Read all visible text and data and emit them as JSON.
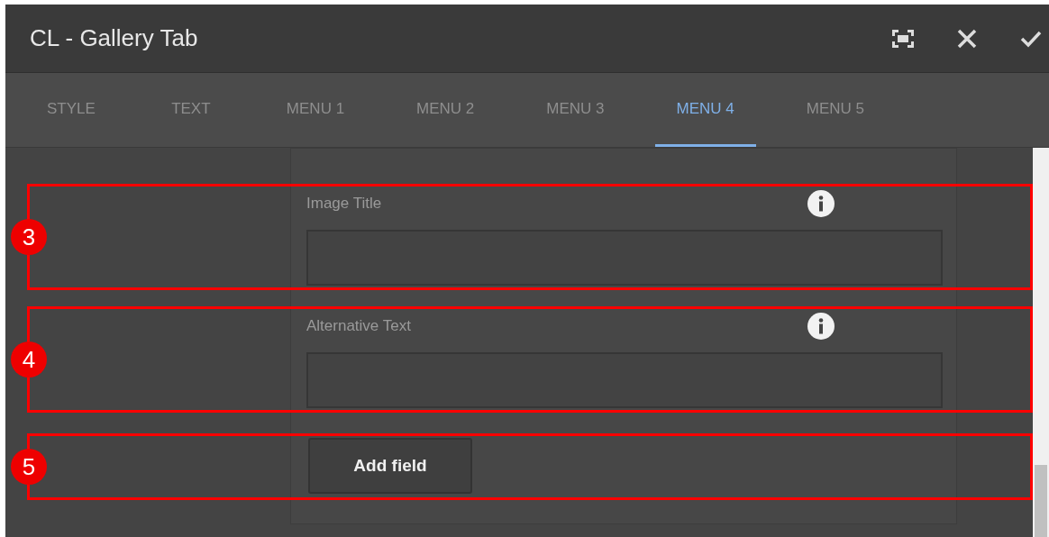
{
  "window": {
    "title": "CL - Gallery Tab"
  },
  "tabs": [
    {
      "label": "STYLE",
      "selected": false
    },
    {
      "label": "TEXT",
      "selected": false
    },
    {
      "label": "MENU 1",
      "selected": false
    },
    {
      "label": "MENU 2",
      "selected": false
    },
    {
      "label": "MENU 3",
      "selected": false
    },
    {
      "label": "MENU 4",
      "selected": true
    },
    {
      "label": "MENU 5",
      "selected": false
    }
  ],
  "sections": [
    {
      "callout": "3",
      "kind": "field",
      "label": "Image Title"
    },
    {
      "callout": "4",
      "kind": "field",
      "label": "Alternative Text"
    },
    {
      "callout": "5",
      "kind": "button",
      "label": "Add field"
    }
  ]
}
